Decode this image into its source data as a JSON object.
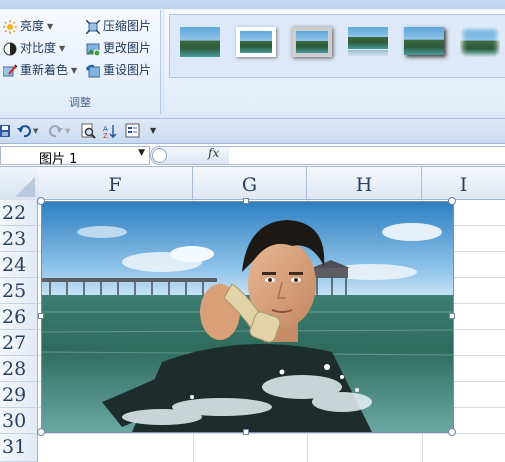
{
  "ribbon": {
    "adjust_group": {
      "label": "调整",
      "commands": [
        {
          "label": "亮度",
          "icon": "brightness-icon",
          "has_dropdown": true
        },
        {
          "label": "压缩图片",
          "icon": "compress-picture-icon",
          "has_dropdown": false
        },
        {
          "label": "对比度",
          "icon": "contrast-icon",
          "has_dropdown": true
        },
        {
          "label": "更改图片",
          "icon": "change-picture-icon",
          "has_dropdown": false
        },
        {
          "label": "重新着色",
          "icon": "recolor-icon",
          "has_dropdown": true
        },
        {
          "label": "重设图片",
          "icon": "reset-picture-icon",
          "has_dropdown": false
        }
      ]
    },
    "picture_styles": [
      {
        "style": "simple-frame"
      },
      {
        "style": "white-frame"
      },
      {
        "style": "gray-frame-shadow"
      },
      {
        "style": "reflected"
      },
      {
        "style": "drop-shadow"
      },
      {
        "style": "soft-edge"
      }
    ]
  },
  "quick_access": {
    "buttons": [
      "save-icon",
      "undo-icon",
      "redo-icon",
      "print-preview-icon",
      "sort-icon",
      "form-icon",
      "customize-dropdown-icon"
    ]
  },
  "formula_bar": {
    "name_box": "图片 1",
    "fx_label": "fx",
    "formula": ""
  },
  "sheet": {
    "columns": [
      "F",
      "G",
      "H",
      "I"
    ],
    "rows": [
      "22",
      "23",
      "24",
      "25",
      "26",
      "27",
      "28",
      "29",
      "30",
      "31"
    ],
    "selected_object": "图片 1"
  },
  "colors": {
    "ribbon_bg": "#dbe7f7",
    "header_text": "#27415f",
    "grid_line": "#d4dbe4"
  }
}
